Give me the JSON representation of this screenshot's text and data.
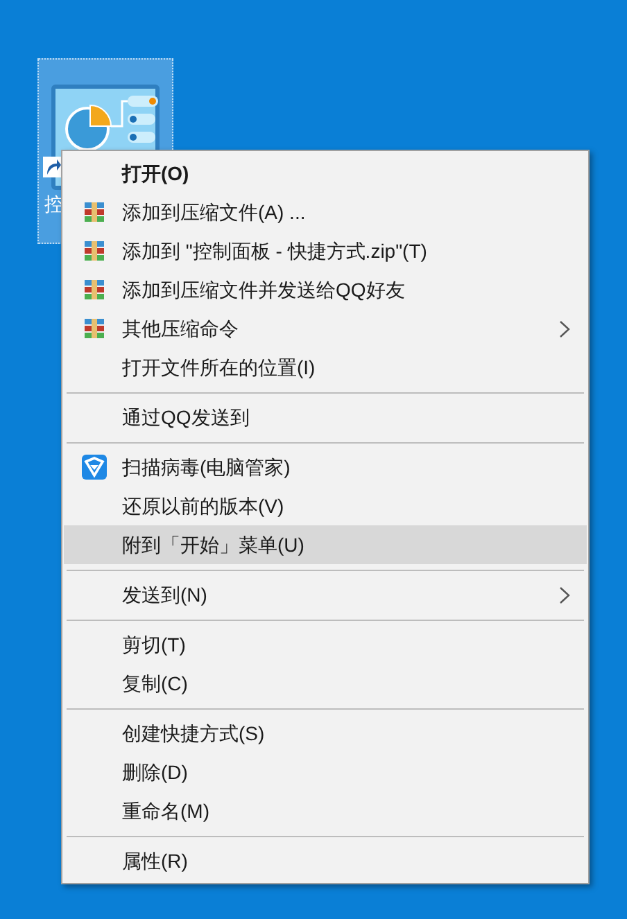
{
  "desktop_icon": {
    "label": "控",
    "selected": true
  },
  "context_menu": {
    "items": [
      {
        "kind": "item",
        "label": "打开(O)",
        "bold": true,
        "selected": false
      },
      {
        "kind": "archive",
        "label": "添加到压缩文件(A) ...",
        "selected": false
      },
      {
        "kind": "archive",
        "label": "添加到 \"控制面板 - 快捷方式.zip\"(T)",
        "selected": false
      },
      {
        "kind": "archive",
        "label": "添加到压缩文件并发送给QQ好友",
        "selected": false
      },
      {
        "kind": "archive",
        "label": "其他压缩命令",
        "submenu": true,
        "selected": false
      },
      {
        "kind": "item",
        "label": "打开文件所在的位置(I)",
        "selected": false
      },
      {
        "kind": "separator"
      },
      {
        "kind": "item",
        "label": "通过QQ发送到",
        "selected": false
      },
      {
        "kind": "separator"
      },
      {
        "kind": "shield",
        "label": "扫描病毒(电脑管家)",
        "selected": false
      },
      {
        "kind": "item",
        "label": "还原以前的版本(V)",
        "selected": false
      },
      {
        "kind": "item",
        "label": "附到「开始」菜单(U)",
        "selected": true
      },
      {
        "kind": "separator"
      },
      {
        "kind": "item",
        "label": "发送到(N)",
        "submenu": true,
        "selected": false
      },
      {
        "kind": "separator"
      },
      {
        "kind": "item",
        "label": "剪切(T)",
        "selected": false
      },
      {
        "kind": "item",
        "label": "复制(C)",
        "selected": false
      },
      {
        "kind": "separator"
      },
      {
        "kind": "item",
        "label": "创建快捷方式(S)",
        "selected": false
      },
      {
        "kind": "item",
        "label": "删除(D)",
        "selected": false
      },
      {
        "kind": "item",
        "label": "重命名(M)",
        "selected": false
      },
      {
        "kind": "separator"
      },
      {
        "kind": "item",
        "label": "属性(R)",
        "selected": false
      }
    ]
  }
}
